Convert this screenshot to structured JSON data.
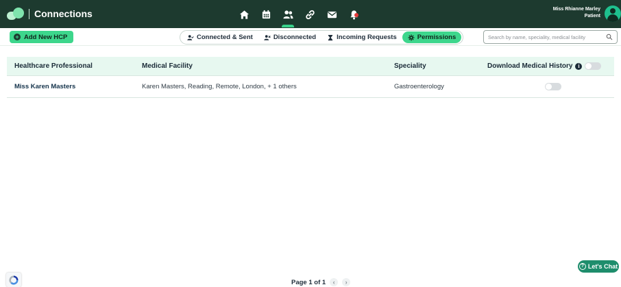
{
  "header": {
    "title": "Connections",
    "nav_icons": [
      "home-icon",
      "calendar-icon",
      "connections-icon",
      "link-icon",
      "mail-icon",
      "bell-icon"
    ],
    "user_name": "Miss Rhianne Marley",
    "user_role": "Patient"
  },
  "toolbar": {
    "add_label": "Add New HCP",
    "tabs": [
      {
        "label": "Connected & Sent",
        "icon": "user-check-icon"
      },
      {
        "label": "Disconnected",
        "icon": "user-x-icon"
      },
      {
        "label": "Incoming Requests",
        "icon": "hourglass-icon"
      },
      {
        "label": "Permissions",
        "icon": "gear-icon",
        "active": true
      }
    ],
    "search_placeholder": "Search by name, speciality, medical facility"
  },
  "table": {
    "headers": {
      "hcp": "Healthcare Professional",
      "facility": "Medical Facility",
      "speciality": "Speciality",
      "download": "Download Medical History"
    },
    "rows": [
      {
        "hcp": "Miss Karen Masters",
        "facility": "Karen Masters, Reading, Remote, London, + 1 others",
        "speciality": "Gastroenterology",
        "download_enabled": false
      }
    ]
  },
  "footer": {
    "page_label": "Page 1 of 1",
    "chat_label": "Let's Chat"
  },
  "colors": {
    "header_bg": "#1d3a2f",
    "accent": "#3dd68c",
    "table_header_bg": "#e7f8f0",
    "chat_bg": "#1e8d6c"
  }
}
